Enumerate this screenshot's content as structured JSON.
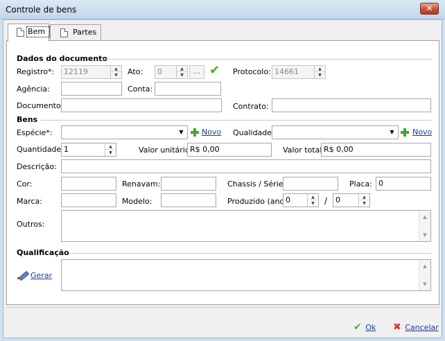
{
  "window": {
    "title": "Controle de bens",
    "close_label": "✕"
  },
  "tabs": [
    {
      "label": "Bem",
      "icon": "document-icon",
      "active": true
    },
    {
      "label": "Partes",
      "icon": "document-icon",
      "active": false
    }
  ],
  "documento": {
    "title": "Dados do documento",
    "registro_label": "Registro*:",
    "registro_value": "12119",
    "ato_label": "Ato:",
    "ato_value": "0",
    "ato_button": "...",
    "protocolo_label": "Protocolo:",
    "protocolo_value": "14661",
    "agencia_label": "Agência:",
    "agencia_value": "",
    "conta_label": "Conta:",
    "conta_value": "",
    "documento_label": "Documento:",
    "documento_value": "",
    "contrato_label": "Contrato:",
    "contrato_value": ""
  },
  "bens": {
    "title": "Bens",
    "especie_label": "Espécie*:",
    "especie_value": "",
    "especie_novo": "Novo",
    "qualidade_label": "Qualidade*:",
    "qualidade_value": "",
    "qualidade_novo": "Novo",
    "quantidade_label": "Quantidade:",
    "quantidade_value": "1",
    "valor_unitario_label": "Valor unitário:",
    "valor_unitario_value": "R$ 0,00",
    "valor_total_label": "Valor total:",
    "valor_total_value": "R$ 0,00",
    "descricao_label": "Descrição:",
    "descricao_value": "",
    "cor_label": "Cor:",
    "cor_value": "",
    "renavam_label": "Renavam:",
    "renavam_value": "",
    "chassis_label": "Chassis / Série:",
    "chassis_value": "",
    "placa_label": "Placa:",
    "placa_value": "0",
    "marca_label": "Marca:",
    "marca_value": "",
    "modelo_label": "Modelo:",
    "modelo_value": "",
    "produzido_label": "Produzido (ano):",
    "produzido_from": "0",
    "produzido_sep": "/",
    "produzido_to": "0",
    "outros_label": "Outros:",
    "outros_value": ""
  },
  "qualificacao": {
    "title": "Qualificação",
    "gerar_label": "Gerar",
    "text_value": ""
  },
  "footer": {
    "ok_label": "Ok",
    "cancel_label": "Cancelar"
  }
}
